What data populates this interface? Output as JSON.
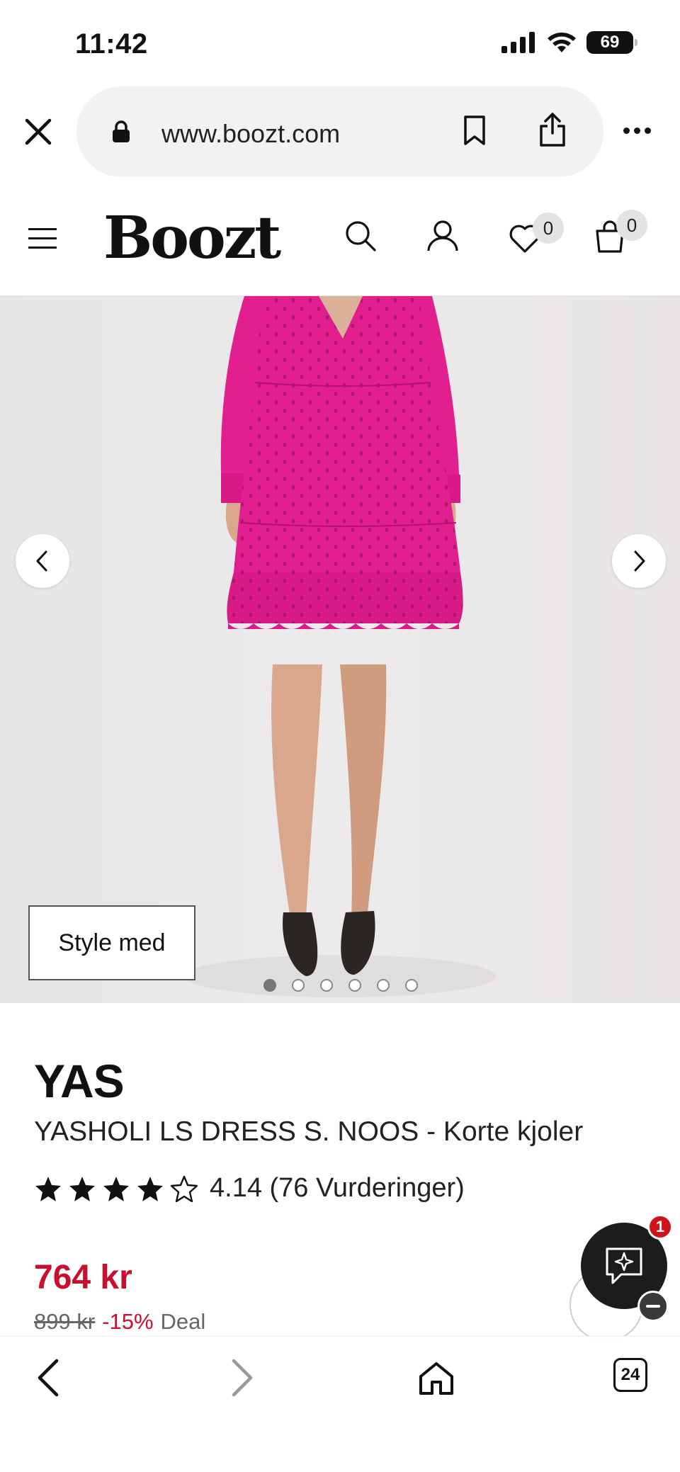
{
  "status_bar": {
    "time": "11:42",
    "battery": "69"
  },
  "browser": {
    "url": "www.boozt.com",
    "tab_count": "24"
  },
  "header": {
    "logo": "Boozt",
    "wishlist_count": "0",
    "cart_count": "0"
  },
  "gallery": {
    "style_button": "Style med",
    "image_count": 6,
    "active_index": 0,
    "dress_color": "#e21f8f"
  },
  "product": {
    "brand": "YAS",
    "title": "YASHOLI LS DRESS S. NOOS - Korte kjoler",
    "rating": {
      "stars_filled": 4,
      "stars_total": 5,
      "text": "4.14 (76 Vurderinger)"
    },
    "price": "764 kr",
    "old_price": "899 kr",
    "discount": "-15%",
    "deal_label": "Deal"
  },
  "chat": {
    "badge": "1"
  },
  "colors": {
    "price_red": "#c8102e",
    "chat_dark": "#1c1c1c",
    "badge_red": "#d0141c"
  }
}
